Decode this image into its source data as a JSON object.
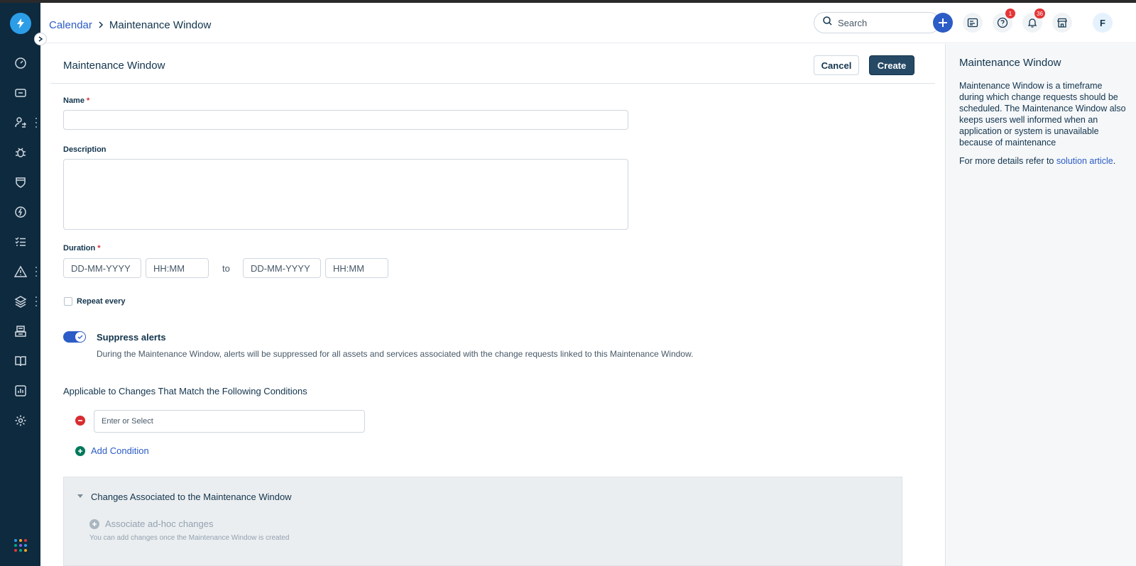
{
  "breadcrumb": {
    "parent": "Calendar",
    "current": "Maintenance Window"
  },
  "header": {
    "search_placeholder": "Search",
    "help_badge": "1",
    "notifications_badge": "36",
    "avatar_initial": "F"
  },
  "form": {
    "title": "Maintenance Window",
    "cancel_label": "Cancel",
    "create_label": "Create",
    "name_label": "Name",
    "name_value": "",
    "required_marker": "*",
    "description_label": "Description",
    "description_value": "",
    "duration_label": "Duration",
    "start_date_placeholder": "DD-MM-YYYY",
    "start_time_placeholder": "HH:MM",
    "to_label": "to",
    "end_date_placeholder": "DD-MM-YYYY",
    "end_time_placeholder": "HH:MM",
    "repeat_label": "Repeat every",
    "repeat_checked": false,
    "suppress_title": "Suppress alerts",
    "suppress_enabled": true,
    "suppress_description": "During the Maintenance Window, alerts will be suppressed for all assets and services associated with the change requests linked to this Maintenance Window.",
    "conditions_title": "Applicable to Changes That Match the Following Conditions",
    "condition_placeholder": "Enter or Select",
    "add_condition_label": "Add Condition"
  },
  "changes_panel": {
    "title": "Changes Associated to the Maintenance Window",
    "associate_label": "Associate ad-hoc changes",
    "hint": "You can add changes once the Maintenance Window is created"
  },
  "help_panel": {
    "title": "Maintenance Window",
    "body": "Maintenance Window is a timeframe during which change requests should be scheduled. The Maintenance Window also keeps users well informed when an application or system is unavailable because of maintenance",
    "more_prefix": "For more details refer to ",
    "more_link": "solution article",
    "more_suffix": "."
  },
  "colors": {
    "sidebar": "#0e2a3f",
    "accent": "#2c5cc5",
    "primary_button": "#264966",
    "danger": "#d72d30",
    "success": "#00795b"
  },
  "sidebar_icons": [
    "dashboard-icon",
    "tickets-icon",
    "people-transfer-icon",
    "bug-icon",
    "shield-icon",
    "lightning-icon",
    "checklist-icon",
    "warning-icon",
    "layers-icon",
    "inbox-icon",
    "book-icon",
    "reports-icon",
    "gear-icon"
  ]
}
